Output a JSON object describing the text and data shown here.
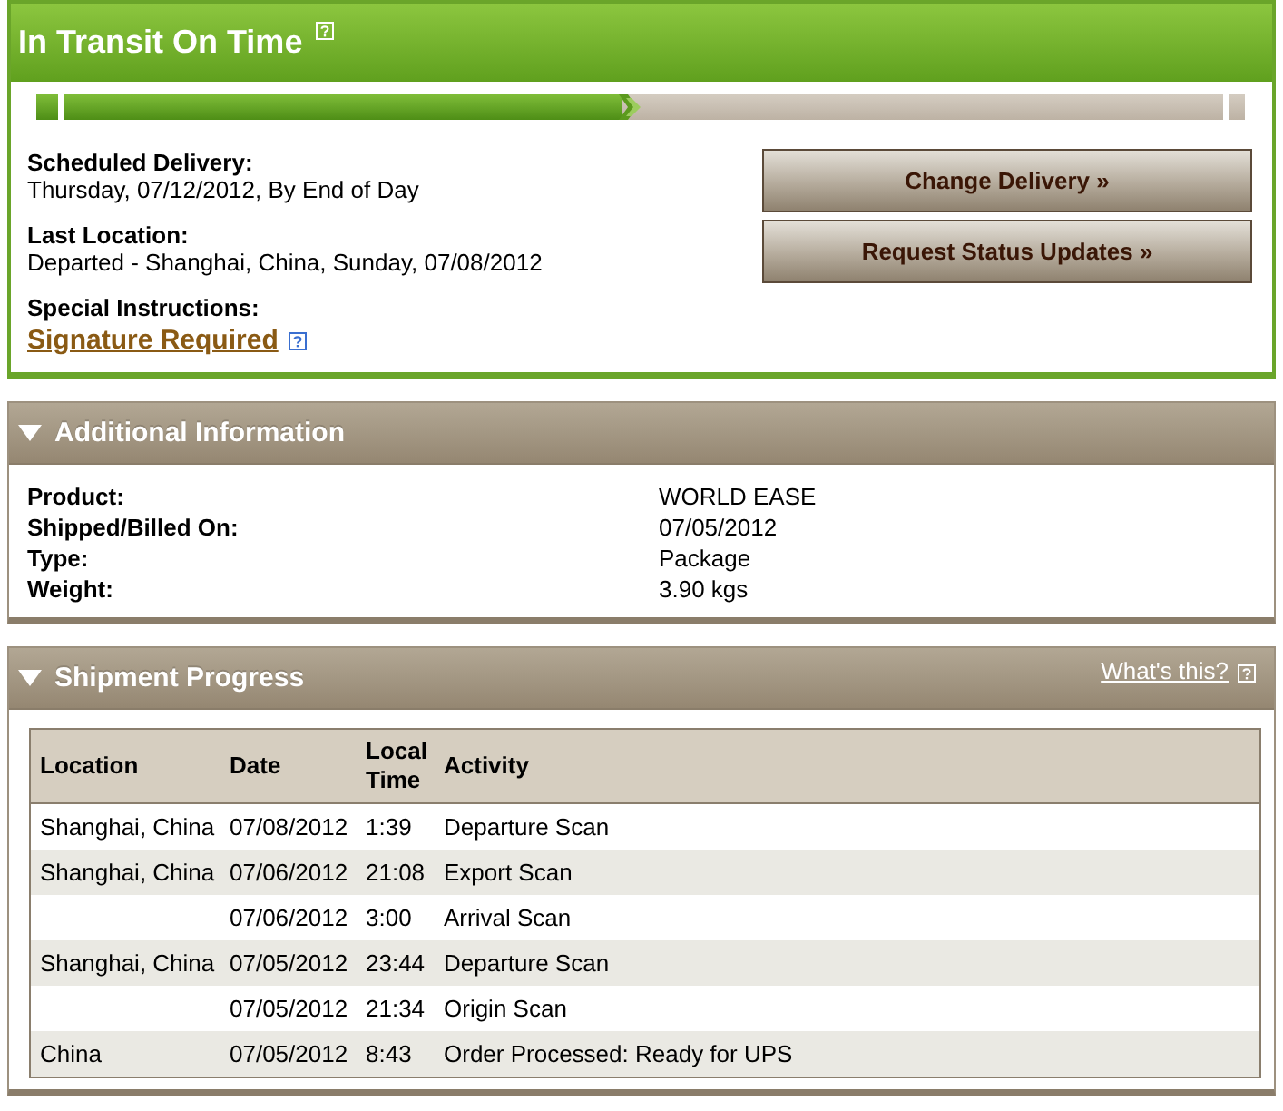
{
  "status": {
    "title": "In Transit On Time",
    "progress": {
      "level": 0.5
    }
  },
  "details": [
    {
      "label": "Scheduled Delivery:",
      "value": "Thursday, 07/12/2012, By End of Day"
    },
    {
      "label": "Last Location:",
      "value": "Departed - Shanghai, China, Sunday, 07/08/2012"
    },
    {
      "label": "Special Instructions:",
      "link": "Signature Required"
    }
  ],
  "actions": [
    "Change Delivery »",
    "Request Status Updates »"
  ],
  "additional_information": {
    "title": "Additional Information",
    "expanded": true,
    "rows": [
      {
        "label": "Product:",
        "value": "WORLD EASE"
      },
      {
        "label": "Shipped/Billed On:",
        "value": "07/05/2012"
      },
      {
        "label": "Type:",
        "value": "Package"
      },
      {
        "label": "Weight:",
        "value": "3.90 kgs"
      }
    ]
  },
  "shipment_progress": {
    "title": "Shipment Progress",
    "expanded": true,
    "help_link": "What's this?",
    "columns": [
      "Location",
      "Date",
      "Local Time",
      "Activity"
    ],
    "rows": [
      {
        "location": "Shanghai, China",
        "date": "07/08/2012",
        "local_time": "1:39",
        "activity": "Departure Scan"
      },
      {
        "location": "Shanghai, China",
        "date": "07/06/2012",
        "local_time": "21:08",
        "activity": "Export Scan"
      },
      {
        "date": "07/06/2012",
        "local_time": "3:00",
        "activity": "Arrival Scan"
      },
      {
        "location": "Shanghai, China",
        "date": "07/05/2012",
        "local_time": "23:44",
        "activity": "Departure Scan"
      },
      {
        "date": "07/05/2012",
        "local_time": "21:34",
        "activity": "Origin Scan"
      },
      {
        "location": "China",
        "date": "07/05/2012",
        "local_time": "8:43",
        "activity": "Order Processed: Ready for UPS"
      }
    ]
  }
}
